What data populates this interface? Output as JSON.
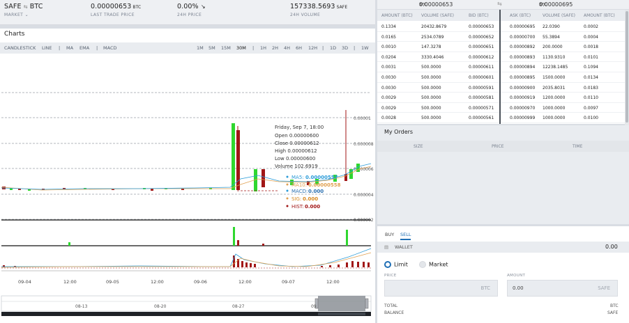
{
  "market": {
    "pair_base": "SAFE",
    "pair_icon": "swap-icon",
    "pair_quote": "BTC",
    "market_label": "MARKET",
    "last_trade_price": "0.00000653",
    "last_trade_unit": "BTC",
    "last_trade_label": "LAST TRADE PRICE",
    "change": "0.00%",
    "change_icon": "arrow-down-right-icon",
    "change_label": "24H PRICE",
    "volume": "157338.5693",
    "volume_unit": "SAFE",
    "volume_label": "24H VOLUME"
  },
  "charts": {
    "title": "Charts",
    "indicator_tools": [
      "CANDLESTICK",
      "LINE",
      "|",
      "MA",
      "EMA",
      "|",
      "MACD"
    ],
    "intervals": [
      "1M",
      "5M",
      "15M",
      "30M",
      "|",
      "1H",
      "2H",
      "4H",
      "6H",
      "12H",
      "|",
      "1D",
      "3D",
      "|",
      "1W"
    ],
    "active_interval": "30M",
    "y_ticks": [
      "0.00001",
      "0.000008",
      "0.000006",
      "0.000004",
      "0.000002"
    ],
    "x_ticks": [
      "09-04",
      "12:00",
      "09-05",
      "12:00",
      "09-06",
      "12:00",
      "09-07",
      "12:00"
    ],
    "nav_ticks": [
      "08-13",
      "08-20",
      "08-27",
      "09"
    ],
    "tooltip": {
      "date": "Friday, Sep 7, 18:00",
      "open": "Open 0.00000600",
      "close": "Close 0.00000612",
      "high": "High 0.00000612",
      "low": "Low 0.00000600",
      "volume": "Volume 102.6919",
      "ma5_label": "MA5:",
      "ma5_value": "0.00000557",
      "ma10_label": "MA10:",
      "ma10_value": "0.00000558",
      "macd_label": "MACD:",
      "macd_value": "0.000",
      "sig_label": "SIG:",
      "sig_value": "0.000",
      "hist_label": "HIST:",
      "hist_value": "0.000"
    },
    "colors": {
      "up": "#2fd72f",
      "down": "#a11616",
      "ma5": "#2a9bd8",
      "ma10": "#e0a050"
    }
  },
  "orderbook": {
    "bid_price": "0.00000653",
    "bid_unit": "BTC",
    "ask_price": "0.00000695",
    "ask_unit": "BTC",
    "columns": [
      "AMOUNT (BTC)",
      "VOLUME (SAFE)",
      "BID (BTC)",
      "ASK (BTC)",
      "VOLUME (SAFE)",
      "AMOUNT (BTC)"
    ],
    "bids": [
      [
        "0.1334",
        "20432.8679",
        "0.00000653"
      ],
      [
        "0.0165",
        "2534.0789",
        "0.00000652"
      ],
      [
        "0.0010",
        "147.3278",
        "0.00000651"
      ],
      [
        "0.0204",
        "3330.4046",
        "0.00000612"
      ],
      [
        "0.0031",
        "500.0000",
        "0.00000611"
      ],
      [
        "0.0030",
        "500.0000",
        "0.00000601"
      ],
      [
        "0.0030",
        "500.0000",
        "0.00000591"
      ],
      [
        "0.0029",
        "500.0000",
        "0.00000581"
      ],
      [
        "0.0029",
        "500.0000",
        "0.00000571"
      ],
      [
        "0.0028",
        "500.0000",
        "0.00000561"
      ]
    ],
    "asks": [
      [
        "0.00000695",
        "22.0390",
        "0.0002"
      ],
      [
        "0.00000700",
        "55.3894",
        "0.0004"
      ],
      [
        "0.00000892",
        "200.0000",
        "0.0018"
      ],
      [
        "0.00000893",
        "1130.9310",
        "0.0101"
      ],
      [
        "0.00000894",
        "12238.1485",
        "0.1094"
      ],
      [
        "0.00000895",
        "1500.0000",
        "0.0134"
      ],
      [
        "0.00000900",
        "2035.8031",
        "0.0183"
      ],
      [
        "0.00000919",
        "1200.0000",
        "0.0110"
      ],
      [
        "0.00000970",
        "1000.0000",
        "0.0097"
      ],
      [
        "0.00000999",
        "1000.0000",
        "0.0100"
      ]
    ]
  },
  "my_orders": {
    "title": "My Orders",
    "columns": [
      "SIZE",
      "PRICE",
      "TIME"
    ]
  },
  "trade": {
    "tab_buy": "BUY",
    "tab_sell": "SELL",
    "active_tab": "SELL",
    "wallet_label": "WALLET",
    "wallet_value": "0.00",
    "order_type_limit": "Limit",
    "order_type_market": "Market",
    "selected_order_type": "Limit",
    "price_label": "PRICE",
    "price_unit": "BTC",
    "amount_label": "AMOUNT",
    "amount_value": "0.00",
    "amount_unit": "SAFE",
    "total_label": "TOTAL",
    "total_unit": "BTC",
    "balance_label": "BALANCE",
    "balance_unit": "SAFE"
  }
}
